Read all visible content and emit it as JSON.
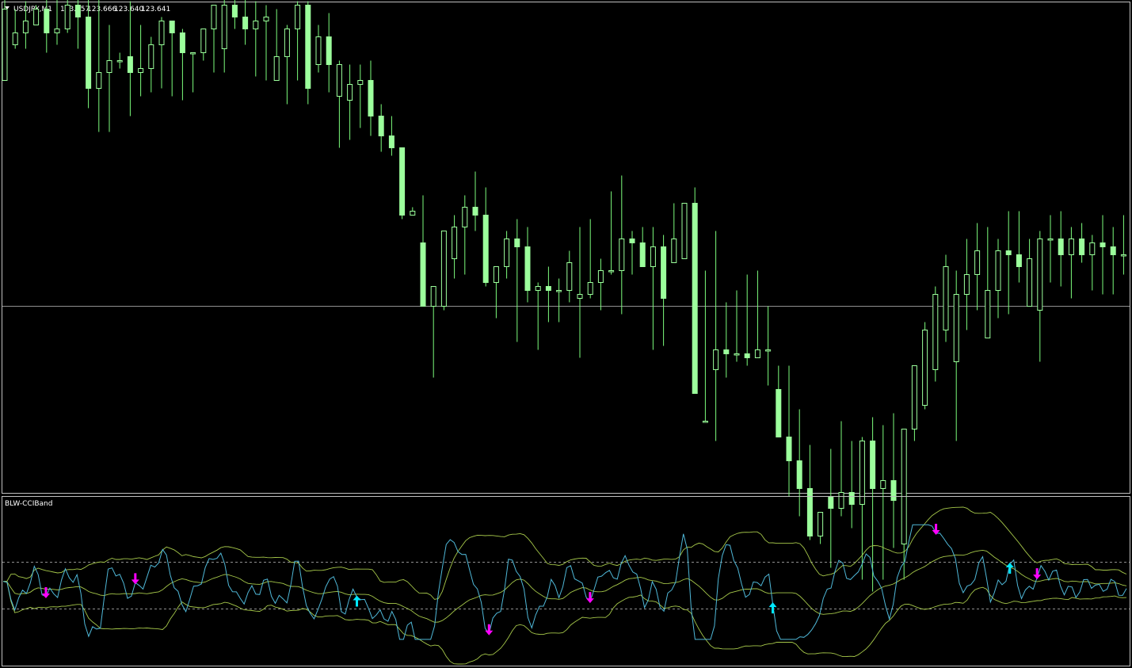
{
  "header": {
    "symbol_label": "USDJPY,M1",
    "open": "123.657",
    "high": "123.666",
    "low": "123.640",
    "close": "123.641"
  },
  "indicator": {
    "name": "BLW-CCIBand"
  },
  "colors": {
    "background": "#000000",
    "candle": "#9cff9c",
    "wick": "#7cfc7c",
    "border": "#c0c0c0",
    "price_line": "#c0c0c0",
    "cci_line": "#4fb8d8",
    "band_line": "#a6c84a",
    "sell_arrow": "#ff00ff",
    "buy_arrow": "#00e8ff",
    "level_line": "#c0c0c0"
  },
  "chart_data": {
    "type": "candlestick",
    "price_line": 123.6,
    "candles": [
      [
        0,
        57,
        84,
        75,
        75
      ],
      [
        1,
        66,
        75,
        65,
        69
      ],
      [
        2,
        69,
        77,
        65,
        72
      ],
      [
        3,
        71,
        76,
        71,
        75
      ],
      [
        4,
        75,
        81,
        64,
        69
      ],
      [
        5,
        69,
        78,
        66,
        70
      ],
      [
        6,
        70,
        82,
        69,
        76
      ],
      [
        7,
        76,
        79,
        65,
        73
      ],
      [
        8,
        73,
        79,
        50,
        55
      ],
      [
        9,
        55,
        79,
        44,
        59
      ],
      [
        10,
        59,
        71,
        44,
        62
      ],
      [
        11,
        62,
        64,
        60,
        62
      ],
      [
        12,
        63,
        77,
        48,
        59
      ],
      [
        13,
        59,
        71,
        53,
        60
      ],
      [
        14,
        60,
        68,
        54,
        66
      ],
      [
        15,
        66,
        73,
        55,
        72
      ],
      [
        16,
        72,
        72,
        53,
        69
      ],
      [
        17,
        69,
        70,
        52,
        64
      ],
      [
        18,
        64,
        64,
        54,
        64
      ],
      [
        19,
        64,
        70,
        62,
        70
      ],
      [
        20,
        70,
        76,
        59,
        76
      ],
      [
        21,
        65,
        80,
        59,
        76
      ],
      [
        22,
        76,
        80,
        70,
        73
      ],
      [
        23,
        73,
        78,
        66,
        70
      ],
      [
        24,
        70,
        77,
        58,
        72
      ],
      [
        25,
        72,
        76,
        57,
        73
      ],
      [
        26,
        57,
        75,
        57,
        63
      ],
      [
        27,
        63,
        71,
        51,
        70
      ],
      [
        28,
        70,
        77,
        57,
        76
      ],
      [
        29,
        76,
        77,
        51,
        55
      ],
      [
        30,
        61,
        71,
        59,
        68
      ],
      [
        31,
        68,
        74,
        54,
        61
      ],
      [
        32,
        53,
        62,
        40,
        61
      ],
      [
        33,
        52,
        61,
        42,
        56
      ],
      [
        34,
        56,
        61,
        45,
        57
      ],
      [
        35,
        57,
        62,
        43,
        48
      ],
      [
        36,
        48,
        51,
        39,
        43
      ],
      [
        37,
        43,
        48,
        38,
        40
      ],
      [
        38,
        40,
        40,
        22,
        23
      ],
      [
        39,
        23,
        25,
        23,
        24
      ],
      [
        40,
        16,
        28,
        0,
        0
      ],
      [
        41,
        0,
        5,
        -18,
        5
      ],
      [
        42,
        0,
        19,
        -1,
        19
      ],
      [
        43,
        12,
        23,
        7,
        20
      ],
      [
        44,
        20,
        28,
        8,
        25
      ],
      [
        45,
        25,
        34,
        19,
        23
      ],
      [
        46,
        23,
        30,
        5,
        6
      ],
      [
        47,
        6,
        10,
        -3,
        10
      ],
      [
        48,
        10,
        19,
        7,
        17
      ],
      [
        49,
        17,
        22,
        -9,
        15
      ],
      [
        50,
        15,
        20,
        1,
        4
      ],
      [
        51,
        4,
        6,
        -11,
        5
      ],
      [
        52,
        5,
        10,
        -4,
        4
      ],
      [
        53,
        4,
        7,
        -4,
        4
      ],
      [
        54,
        4,
        14,
        1,
        11
      ],
      [
        55,
        2,
        20,
        -13,
        3
      ],
      [
        56,
        3,
        22,
        2,
        6
      ],
      [
        57,
        6,
        12,
        -1,
        9
      ],
      [
        58,
        9,
        29,
        8,
        9
      ],
      [
        59,
        9,
        33,
        -2,
        17
      ],
      [
        60,
        17,
        19,
        8,
        16
      ],
      [
        61,
        16,
        20,
        10,
        10
      ],
      [
        62,
        10,
        20,
        -11,
        15
      ],
      [
        63,
        15,
        18,
        -10,
        2
      ],
      [
        64,
        11,
        26,
        11,
        17
      ],
      [
        65,
        12,
        26,
        12,
        26
      ],
      [
        66,
        26,
        30,
        -22,
        -22
      ],
      [
        67,
        -29,
        9,
        -29,
        -29
      ],
      [
        68,
        -16,
        19,
        -34,
        -11
      ],
      [
        69,
        -11,
        1,
        -18,
        -12
      ],
      [
        70,
        -12,
        4,
        -14,
        -12
      ],
      [
        71,
        -12,
        8,
        -15,
        -13
      ],
      [
        72,
        -13,
        9,
        -13,
        -11
      ],
      [
        73,
        -11,
        0,
        -20,
        -11
      ],
      [
        74,
        -21,
        -15,
        -33,
        -33
      ],
      [
        75,
        -33,
        -15,
        -48,
        -39
      ],
      [
        76,
        -39,
        -26,
        -53,
        -46
      ],
      [
        77,
        -46,
        -35,
        -59,
        -58
      ],
      [
        78,
        -58,
        -52,
        -60,
        -52
      ],
      [
        79,
        -48,
        -36,
        -66,
        -51
      ],
      [
        80,
        -51,
        -29,
        -53,
        -47
      ],
      [
        81,
        -47,
        -34,
        -56,
        -50
      ],
      [
        82,
        -50,
        -33,
        -69,
        -34
      ],
      [
        83,
        -34,
        -28,
        -72,
        -46
      ],
      [
        84,
        -46,
        -30,
        -69,
        -44
      ],
      [
        85,
        -44,
        -27,
        -61,
        -49
      ],
      [
        86,
        -60,
        -31,
        -69,
        -31
      ],
      [
        87,
        -31,
        -15,
        -34,
        -15
      ],
      [
        88,
        -25,
        -4,
        -26,
        -6
      ],
      [
        89,
        -16,
        5,
        -19,
        3
      ],
      [
        90,
        -6,
        13,
        -9,
        10
      ],
      [
        91,
        -14,
        9,
        -34,
        3
      ],
      [
        92,
        3,
        17,
        -6,
        8
      ],
      [
        93,
        8,
        21,
        -1,
        14
      ],
      [
        94,
        -8,
        20,
        -8,
        4
      ],
      [
        95,
        4,
        17,
        -3,
        14
      ],
      [
        96,
        14,
        24,
        -2,
        13
      ],
      [
        97,
        13,
        24,
        6,
        10
      ],
      [
        98,
        0,
        17,
        0,
        12
      ],
      [
        99,
        -1,
        19,
        -14,
        17
      ],
      [
        100,
        17,
        23,
        6,
        17
      ],
      [
        101,
        17,
        24,
        5,
        13
      ],
      [
        102,
        13,
        20,
        2,
        17
      ],
      [
        103,
        17,
        21,
        11,
        13
      ],
      [
        104,
        13,
        18,
        4,
        16
      ],
      [
        105,
        16,
        23,
        3,
        15
      ],
      [
        106,
        15,
        20,
        3,
        13
      ],
      [
        107,
        13,
        23,
        8,
        13
      ]
    ],
    "note_x_units": "candle index",
    "cci": {
      "upper_level": 100,
      "lower_level": -100,
      "sell_arrow_indices": [
        11,
        34,
        125,
        151,
        240,
        266
      ],
      "buy_arrow_indices": [
        91,
        198,
        259
      ]
    }
  }
}
